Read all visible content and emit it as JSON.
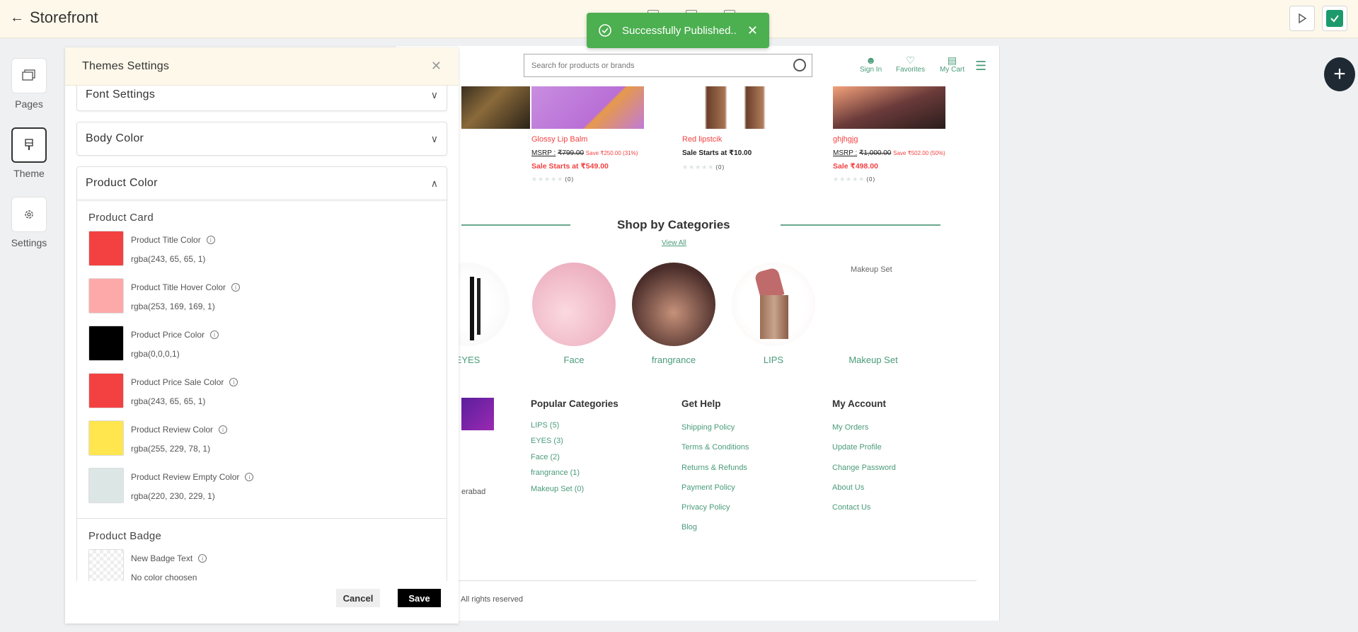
{
  "app": {
    "title": "Storefront"
  },
  "toast": {
    "message": "Successfully Published.."
  },
  "rail": [
    {
      "label": "Pages"
    },
    {
      "label": "Theme"
    },
    {
      "label": "Settings"
    }
  ],
  "panel": {
    "title": "Themes Settings",
    "accordions": {
      "font": "Font Settings",
      "body": "Body Color",
      "product": "Product Color"
    },
    "product_card": {
      "title": "Product Card",
      "colors": [
        {
          "name": "Product Title Color",
          "value": "rgba(243, 65, 65, 1)",
          "hex": "#f34141"
        },
        {
          "name": "Product Title Hover Color",
          "value": "rgba(253, 169, 169, 1)",
          "hex": "#fda9a9"
        },
        {
          "name": "Product Price Color",
          "value": "rgba(0,0,0,1)",
          "hex": "#000000"
        },
        {
          "name": "Product Price Sale Color",
          "value": "rgba(243, 65, 65, 1)",
          "hex": "#f34141"
        },
        {
          "name": "Product Review Color",
          "value": "rgba(255, 229, 78, 1)",
          "hex": "#ffe54e"
        },
        {
          "name": "Product Review Empty Color",
          "value": "rgba(220, 230, 229, 1)",
          "hex": "#dce6e5"
        }
      ]
    },
    "product_badge": {
      "title": "Product Badge",
      "colors": [
        {
          "name": "New Badge Text",
          "value": "No color choosen"
        }
      ]
    },
    "cancel_label": "Cancel",
    "save_label": "Save"
  },
  "preview": {
    "search_placeholder": "Search for products or brands",
    "nav": {
      "sign_in": "Sign In",
      "favorites": "Favorites",
      "cart": "My Cart"
    },
    "products": [
      {
        "name": "Glossy Lip Balm",
        "msrp_label": "MSRP :",
        "msrp": "₹799.00",
        "save": "Save ₹250.00 (31%)",
        "sale_label": "Sale Starts at",
        "sale_price": "₹549.00",
        "reviews": "(0)"
      },
      {
        "name": "Red lipstcik",
        "price_label": "Sale Starts at",
        "price": "₹10.00",
        "reviews": "(0)"
      },
      {
        "name": "ghjhgjg",
        "msrp_label": "MSRP :",
        "msrp": "₹1,000.00",
        "save": "Save ₹502.00 (50%)",
        "sale_label": "Sale",
        "sale_price": "₹498.00",
        "reviews": "(0)"
      }
    ],
    "categories_title": "Shop by Categories",
    "view_all": "View All",
    "categories": [
      "EYES",
      "Face",
      "frangrance",
      "LIPS",
      "Makeup Set"
    ],
    "makeup_alt": "Makeup Set",
    "footer": {
      "popular_title": "Popular Categories",
      "popular": [
        "LIPS (5)",
        "EYES (3)",
        "Face (2)",
        "frangrance (1)",
        "Makeup Set (0)"
      ],
      "help_title": "Get Help",
      "help": [
        "Shipping Policy",
        "Terms & Conditions",
        "Returns & Refunds",
        "Payment Policy",
        "Privacy Policy",
        "Blog"
      ],
      "account_title": "My Account",
      "account": [
        "My Orders",
        "Update Profile",
        "Change Password",
        "About Us",
        "Contact Us"
      ],
      "address_fragment": "erabad",
      "copyright": "All rights reserved"
    }
  }
}
